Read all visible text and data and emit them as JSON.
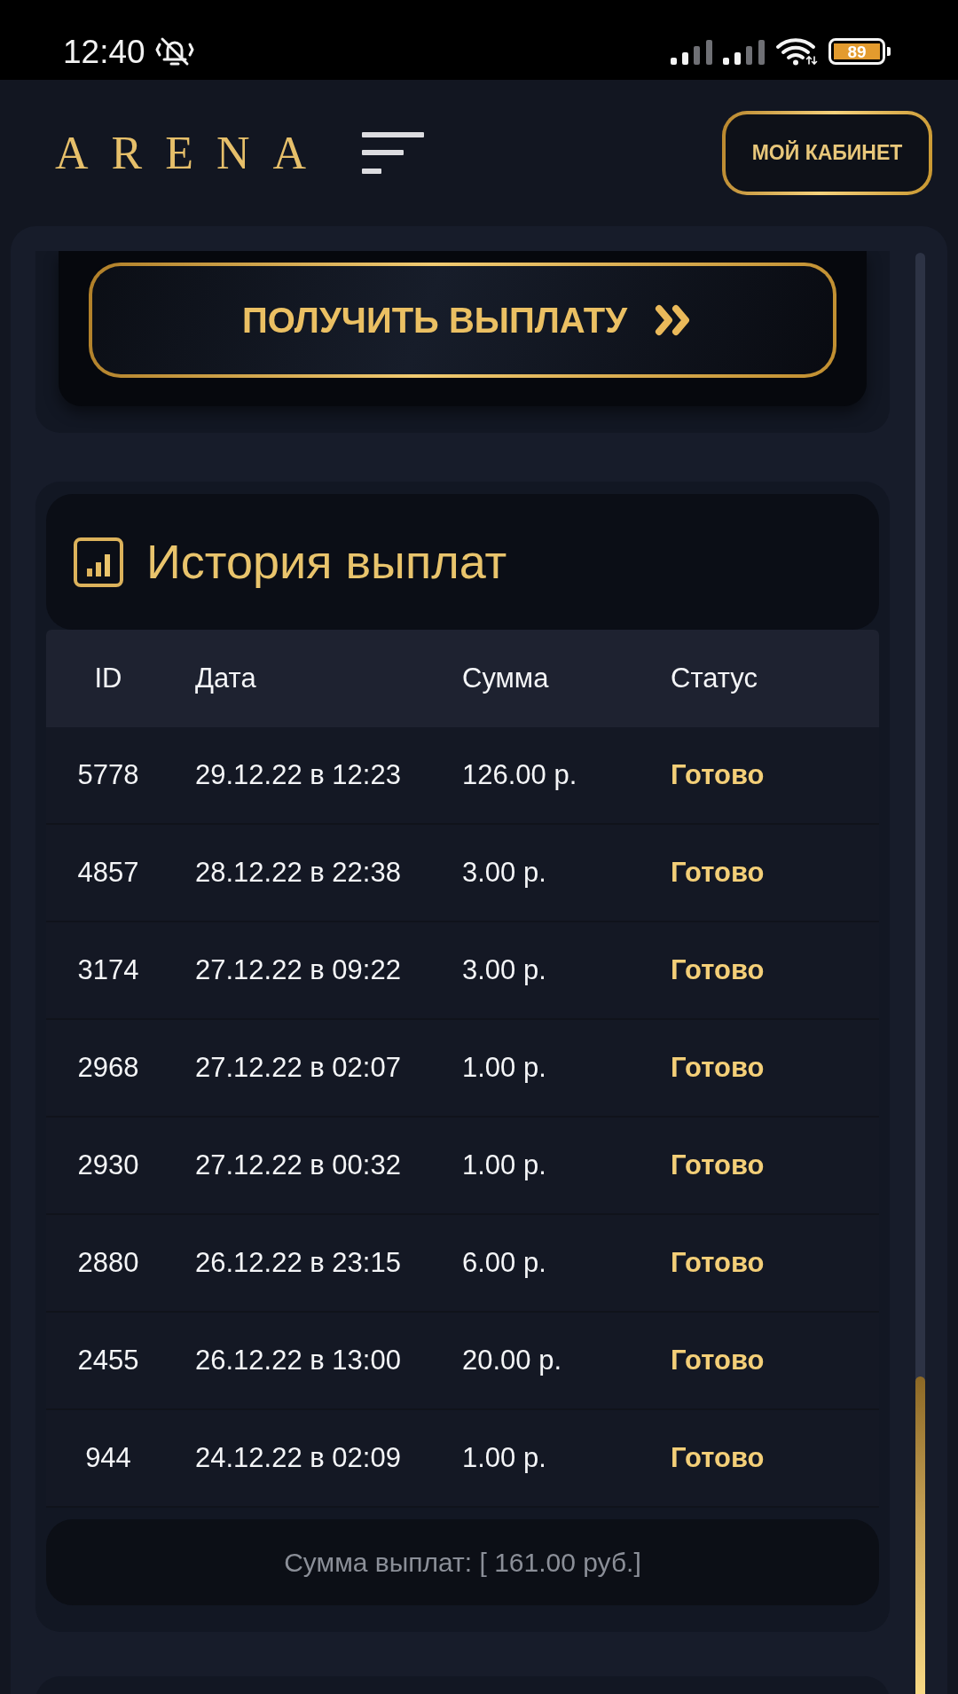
{
  "status_bar": {
    "time": "12:40",
    "battery": "89"
  },
  "header": {
    "logo": "ARENA",
    "cabinet_button": "МОЙ КАБИНЕТ"
  },
  "payout_button": {
    "label": "ПОЛУЧИТЬ ВЫПЛАТУ"
  },
  "history": {
    "title": "История выплат",
    "columns": [
      "ID",
      "Дата",
      "Сумма",
      "Статус"
    ],
    "rows": [
      {
        "id": "5778",
        "date": "29.12.22 в 12:23",
        "amount": "126.00 р.",
        "status": "Готово"
      },
      {
        "id": "4857",
        "date": "28.12.22 в 22:38",
        "amount": "3.00 р.",
        "status": "Готово"
      },
      {
        "id": "3174",
        "date": "27.12.22 в 09:22",
        "amount": "3.00 р.",
        "status": "Готово"
      },
      {
        "id": "2968",
        "date": "27.12.22 в 02:07",
        "amount": "1.00 р.",
        "status": "Готово"
      },
      {
        "id": "2930",
        "date": "27.12.22 в 00:32",
        "amount": "1.00 р.",
        "status": "Готово"
      },
      {
        "id": "2880",
        "date": "26.12.22 в 23:15",
        "amount": "6.00 р.",
        "status": "Готово"
      },
      {
        "id": "2455",
        "date": "26.12.22 в 13:00",
        "amount": "20.00 р.",
        "status": "Готово"
      },
      {
        "id": "944",
        "date": "24.12.22 в 02:09",
        "amount": "1.00 р.",
        "status": "Готово"
      }
    ],
    "total": "Сумма выплат: [ 161.00 руб.]"
  }
}
